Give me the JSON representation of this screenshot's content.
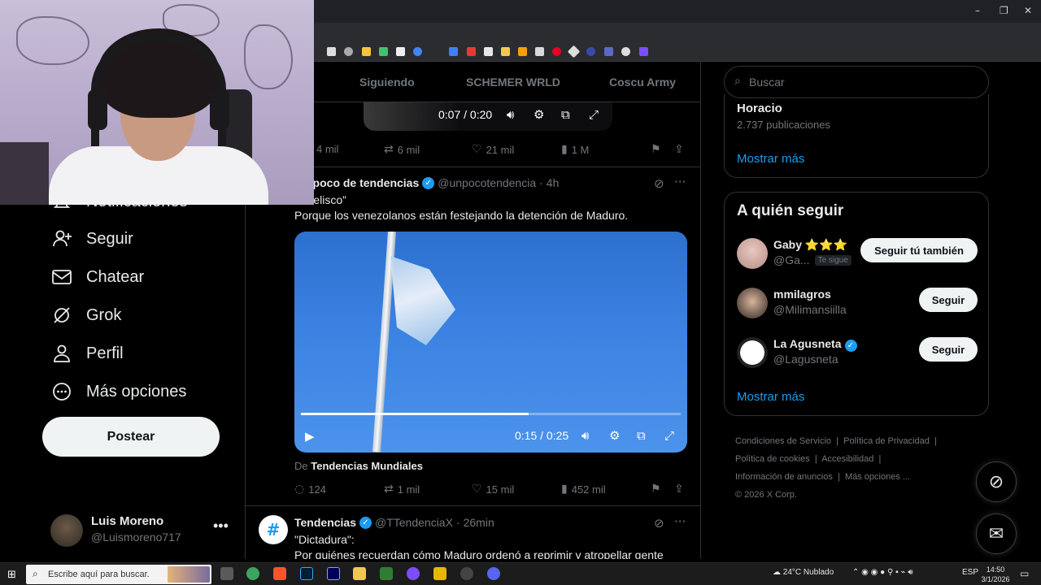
{
  "feed": {
    "tabs": [
      "Siguiendo",
      "SCHEMER WRLD",
      "Coscu Army"
    ],
    "top_video": {
      "time": "0:07 / 0:20"
    },
    "top_actions": {
      "replies": "4 mil",
      "reposts": "6 mil",
      "likes": "21 mil",
      "views": "1 M"
    },
    "tweet1": {
      "name": "Un poco de tendencias",
      "handle": "@unpocotendencia",
      "time": "4h",
      "line1": "“Obelisco”",
      "line2": "Porque los venezolanos están festejando la detención de Maduro.",
      "video_time": "0:15 / 0:25",
      "progress": 0.6,
      "source_prefix": "De",
      "source_name": "Tendencias Mundiales",
      "replies": "124",
      "reposts": "1 mil",
      "likes": "15 mil",
      "views": "452 mil"
    },
    "tweet2": {
      "name": "Tendencias",
      "handle": "@TTendenciaX",
      "time": "26min",
      "line1": "\"Dictadura\":",
      "line2": "Por quiénes recuerdan cómo Maduro ordenó a reprimir y atropellar gente"
    }
  },
  "nav": {
    "items": [
      {
        "label": "Notificaciones",
        "icon": "bell-icon"
      },
      {
        "label": "Seguir",
        "icon": "follow-icon"
      },
      {
        "label": "Chatear",
        "icon": "mail-icon"
      },
      {
        "label": "Grok",
        "icon": "grok-icon"
      },
      {
        "label": "Perfil",
        "icon": "person-icon"
      },
      {
        "label": "Más opciones",
        "icon": "more-circle-icon"
      }
    ],
    "post_label": "Postear",
    "account_name": "Luis Moreno",
    "account_handle": "@Luismoreno717"
  },
  "right": {
    "search_placeholder": "Buscar",
    "trend_name": "Horacio",
    "trend_count": "2.737 publicaciones",
    "show_more": "Mostrar más",
    "who_title": "A quién seguir",
    "who": [
      {
        "name": "Gaby ⭐⭐⭐",
        "handle": "@Ga...",
        "follows_you": "Te sigue",
        "button": "Seguir tú también",
        "verified": false
      },
      {
        "name": "mmilagros",
        "handle": "@Milimansiilla",
        "button": "Seguir",
        "verified": false
      },
      {
        "name": "La Agusneta",
        "handle": "@Lagusneta",
        "button": "Seguir",
        "verified": true
      }
    ],
    "footer": [
      "Condiciones de Servicio",
      "Política de Privacidad",
      "Política de cookies",
      "Accesibilidad",
      "Información de anuncios",
      "Más opciones ...",
      "© 2026 X Corp."
    ]
  },
  "taskbar": {
    "search_placeholder": "Escribe aquí para buscar.",
    "weather": "24°C  Nublado",
    "lang": "ESP",
    "time": "14:50",
    "date": "3/1/2026"
  },
  "colors": {
    "accent": "#1d9bf0",
    "background": "#000000",
    "muted": "#71767b"
  }
}
